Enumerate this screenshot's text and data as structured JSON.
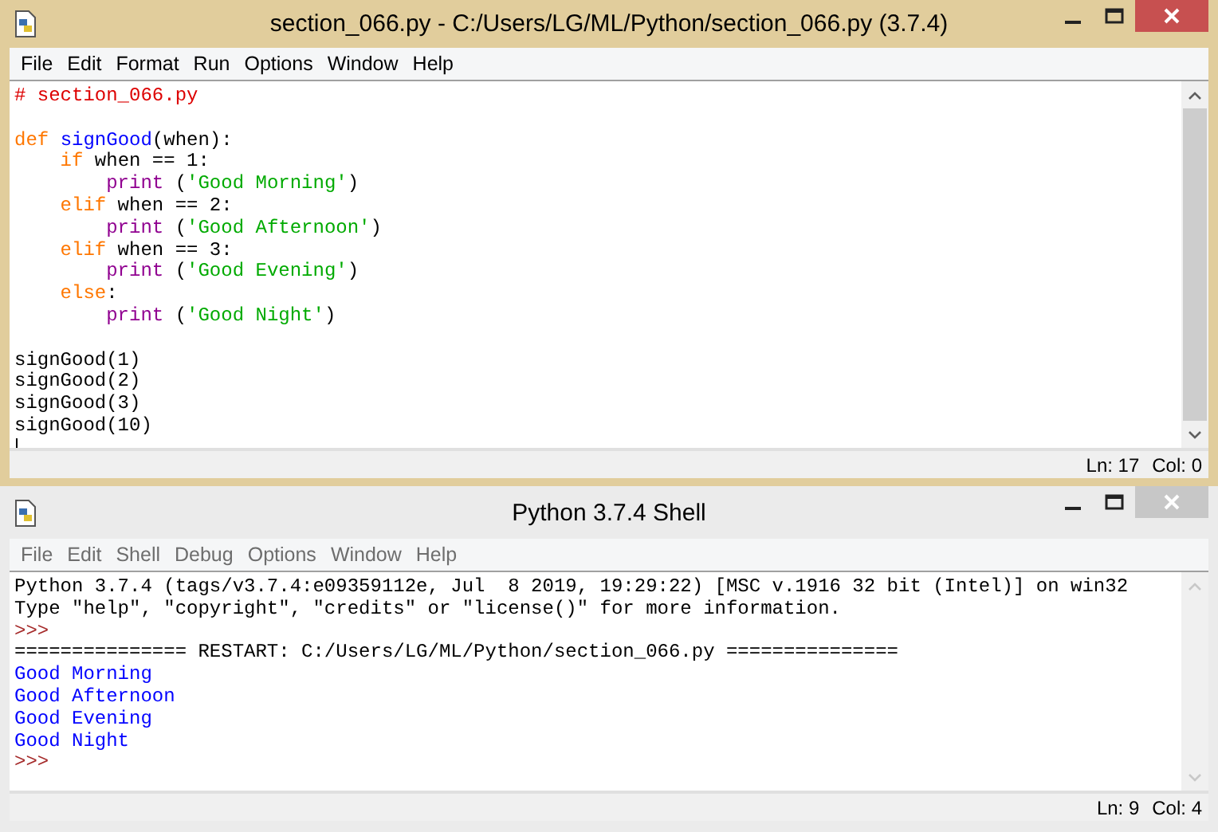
{
  "editor_window": {
    "title": "section_066.py - C:/Users/LG/ML/Python/section_066.py (3.7.4)",
    "active": true,
    "menu": [
      "File",
      "Edit",
      "Format",
      "Run",
      "Options",
      "Window",
      "Help"
    ],
    "lines": [
      {
        "kind": "code",
        "tokens": [
          {
            "kind": "comment",
            "text": "# section_066.py"
          }
        ]
      },
      {
        "kind": "blank"
      },
      {
        "kind": "code",
        "tokens": [
          {
            "kind": "keyword",
            "text": "def "
          },
          {
            "kind": "definition",
            "text": "signGood"
          },
          {
            "kind": "plain",
            "text": "(when):"
          }
        ]
      },
      {
        "kind": "code",
        "tokens": [
          {
            "kind": "keyword",
            "text": "    if"
          },
          {
            "kind": "plain",
            "text": " when == 1:"
          }
        ]
      },
      {
        "kind": "code",
        "tokens": [
          {
            "kind": "builtin",
            "text": "        print"
          },
          {
            "kind": "plain",
            "text": " ("
          },
          {
            "kind": "string",
            "text": "'Good Morning'"
          },
          {
            "kind": "plain",
            "text": ")"
          }
        ]
      },
      {
        "kind": "code",
        "tokens": [
          {
            "kind": "keyword",
            "text": "    elif"
          },
          {
            "kind": "plain",
            "text": " when == 2:"
          }
        ]
      },
      {
        "kind": "code",
        "tokens": [
          {
            "kind": "builtin",
            "text": "        print"
          },
          {
            "kind": "plain",
            "text": " ("
          },
          {
            "kind": "string",
            "text": "'Good Afternoon'"
          },
          {
            "kind": "plain",
            "text": ")"
          }
        ]
      },
      {
        "kind": "code",
        "tokens": [
          {
            "kind": "keyword",
            "text": "    elif"
          },
          {
            "kind": "plain",
            "text": " when == 3:"
          }
        ]
      },
      {
        "kind": "code",
        "tokens": [
          {
            "kind": "builtin",
            "text": "        print"
          },
          {
            "kind": "plain",
            "text": " ("
          },
          {
            "kind": "string",
            "text": "'Good Evening'"
          },
          {
            "kind": "plain",
            "text": ")"
          }
        ]
      },
      {
        "kind": "code",
        "tokens": [
          {
            "kind": "keyword",
            "text": "    else"
          },
          {
            "kind": "plain",
            "text": ":"
          }
        ]
      },
      {
        "kind": "code",
        "tokens": [
          {
            "kind": "builtin",
            "text": "        print"
          },
          {
            "kind": "plain",
            "text": " ("
          },
          {
            "kind": "string",
            "text": "'Good Night'"
          },
          {
            "kind": "plain",
            "text": ")"
          }
        ]
      },
      {
        "kind": "blank"
      },
      {
        "kind": "code",
        "tokens": [
          {
            "kind": "plain",
            "text": "signGood(1)"
          }
        ]
      },
      {
        "kind": "code",
        "tokens": [
          {
            "kind": "plain",
            "text": "signGood(2)"
          }
        ]
      },
      {
        "kind": "code",
        "tokens": [
          {
            "kind": "plain",
            "text": "signGood(3)"
          }
        ]
      },
      {
        "kind": "code",
        "tokens": [
          {
            "kind": "plain",
            "text": "signGood(10)"
          }
        ]
      }
    ],
    "status": [
      "Ln: 17",
      "Col: 0"
    ]
  },
  "shell_window": {
    "title": "Python 3.7.4 Shell",
    "active": false,
    "menu": [
      "File",
      "Edit",
      "Shell",
      "Debug",
      "Options",
      "Window",
      "Help"
    ],
    "lines": [
      {
        "kind": "plain",
        "text": "Python 3.7.4 (tags/v3.7.4:e09359112e, Jul  8 2019, 19:29:22) [MSC v.1916 32 bit (Intel)] on win32"
      },
      {
        "kind": "plain",
        "text": "Type \"help\", \"copyright\", \"credits\" or \"license()\" for more information."
      },
      {
        "kind": "prompt",
        "text": ">>>"
      },
      {
        "kind": "plain",
        "text": "=============== RESTART: C:/Users/LG/ML/Python/section_066.py ==============="
      },
      {
        "kind": "output",
        "text": "Good Morning"
      },
      {
        "kind": "output",
        "text": "Good Afternoon"
      },
      {
        "kind": "output",
        "text": "Good Evening"
      },
      {
        "kind": "output",
        "text": "Good Night"
      },
      {
        "kind": "prompt",
        "text": ">>>"
      }
    ],
    "status": [
      "Ln: 9",
      "Col: 4"
    ]
  }
}
